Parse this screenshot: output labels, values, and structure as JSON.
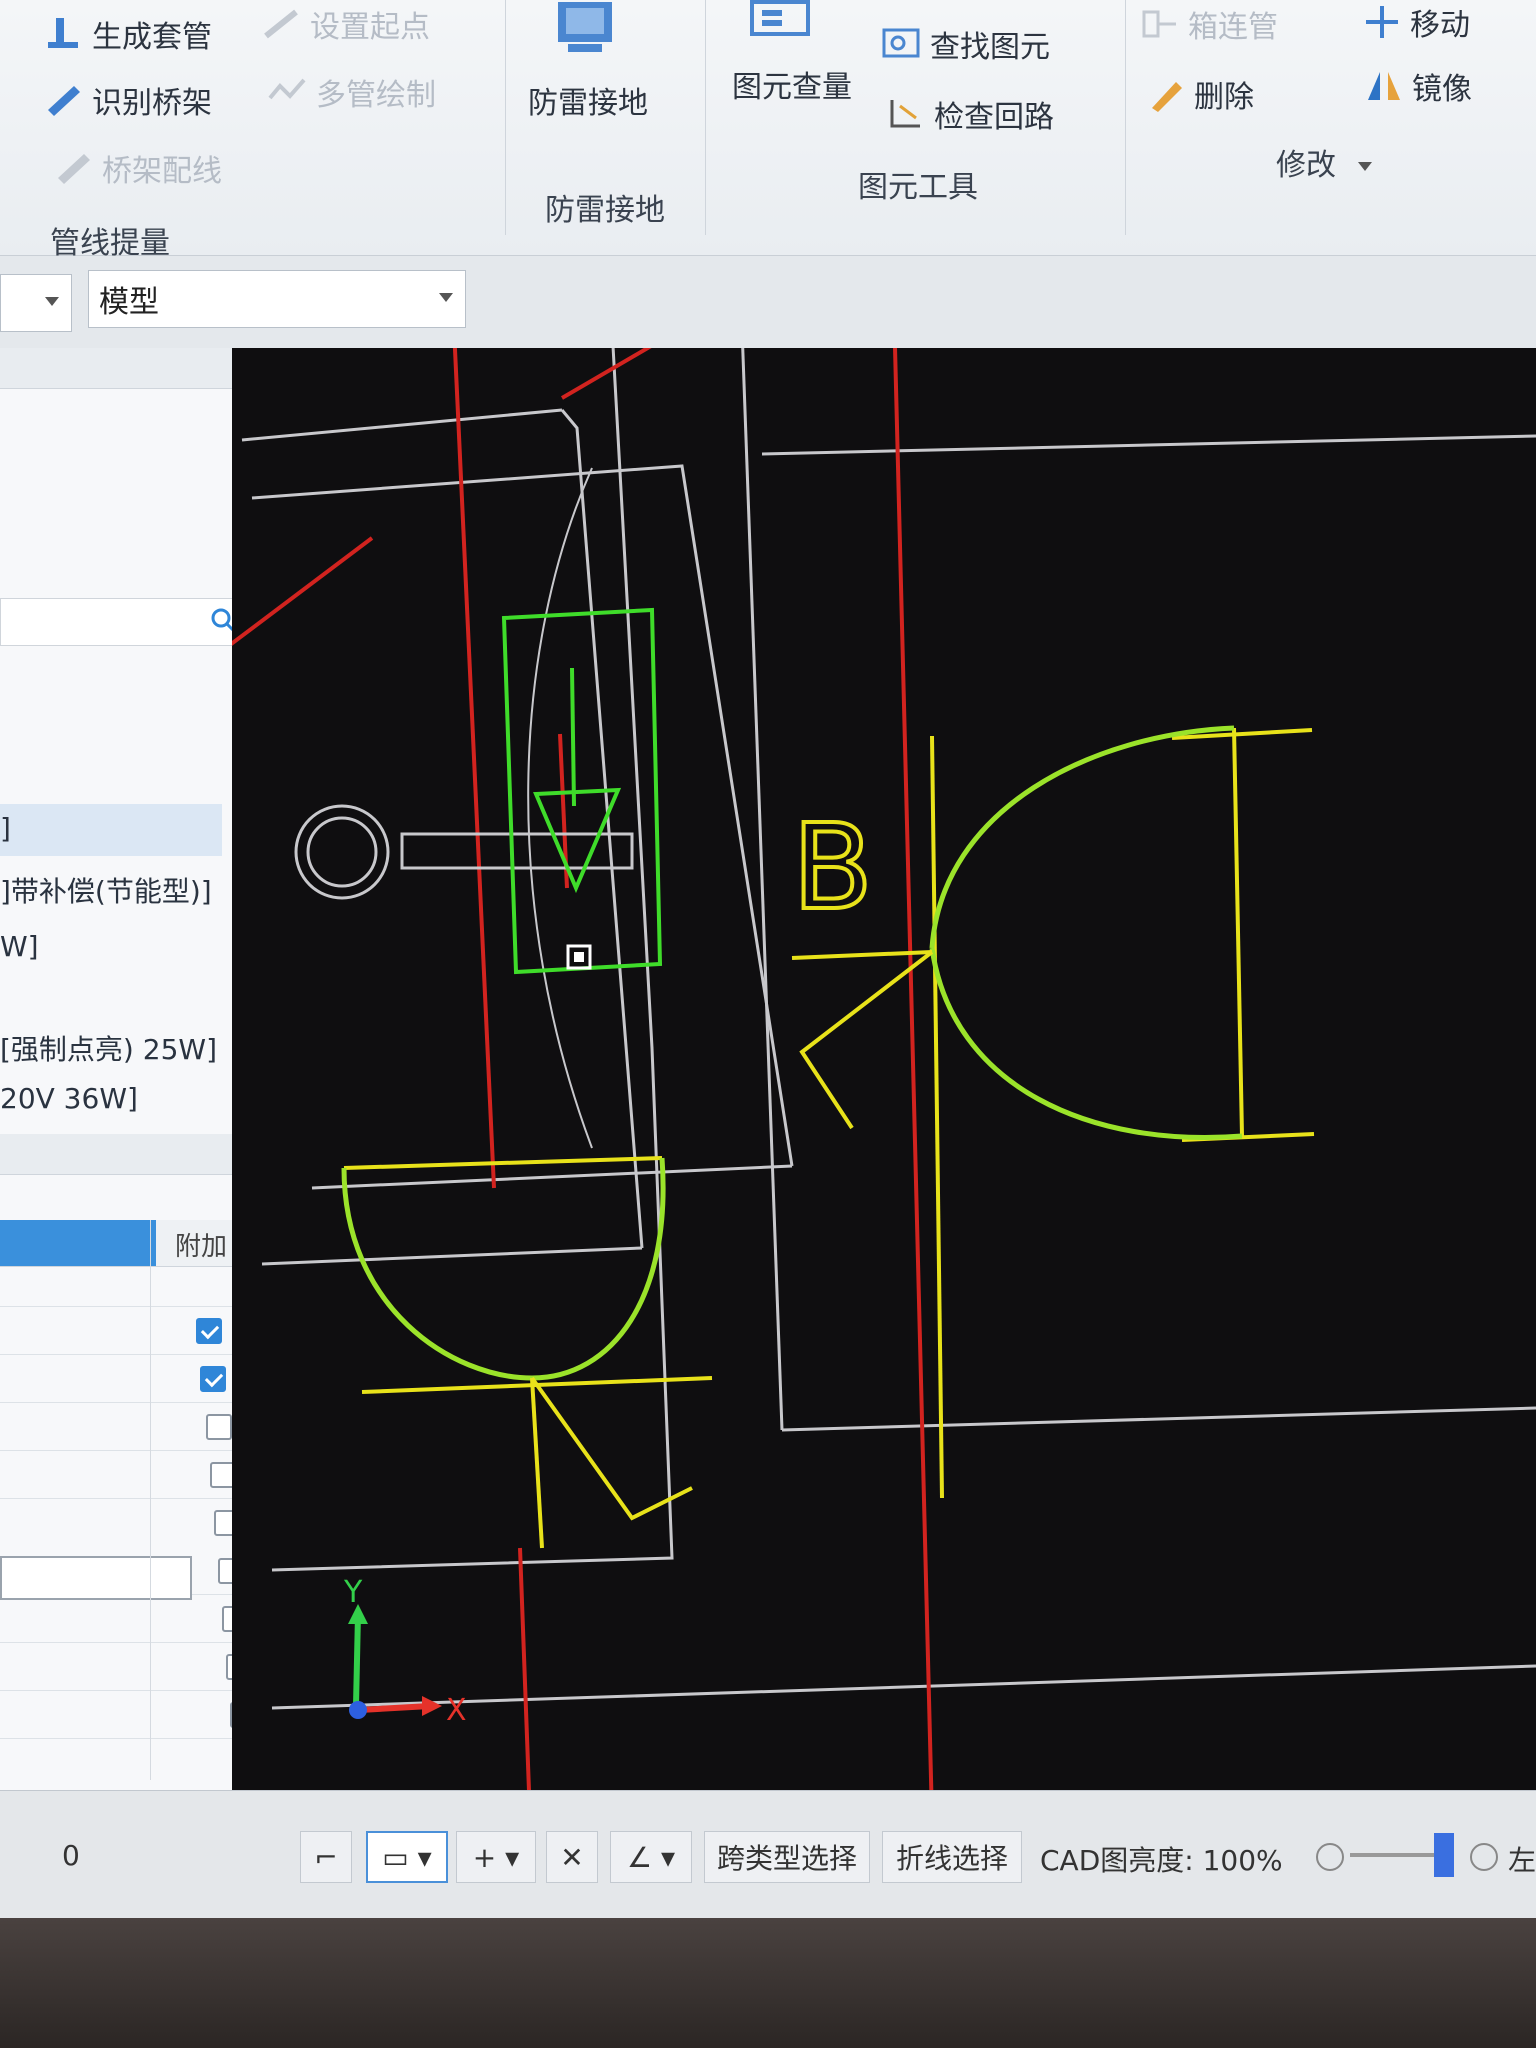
{
  "ribbon": {
    "groups": [
      {
        "label": "管线提量",
        "buttons": [
          "生成套管",
          "识别桥架",
          "桥架配线",
          "设置起点",
          "多管绘制"
        ]
      },
      {
        "label": "防雷接地",
        "buttons": [
          "防雷接地"
        ]
      },
      {
        "label": "图元工具",
        "buttons": [
          "图元查量",
          "查找图元",
          "检查回路"
        ]
      },
      {
        "label": "修改",
        "buttons": [
          "箱连管",
          "删除",
          "移动",
          "镜像"
        ]
      }
    ]
  },
  "selector": {
    "model": "模型"
  },
  "left_panel": {
    "list_items": [
      "]",
      "]带补偿(节能型)]",
      "W]",
      "[强制点亮) 25W]",
      "20V 36W]"
    ],
    "table_header": "附加",
    "checkboxes": [
      true,
      true,
      false,
      false,
      false,
      false,
      false,
      false,
      false,
      false
    ],
    "count_value": "0"
  },
  "drawing": {
    "label_b": "B",
    "axis_x": "X",
    "axis_y": "Y",
    "colors": {
      "red": "#d2231f",
      "yellow": "#e8e21a",
      "green": "#3fdc2a",
      "gray": "#c8c8cc",
      "background": "#0f0e10"
    }
  },
  "statusbar": {
    "cross_select": "跨类型选择",
    "polyline_select": "折线选择",
    "cad_brightness_label": "CAD图亮度:",
    "cad_brightness_value": "100%",
    "right_edge": "左"
  }
}
